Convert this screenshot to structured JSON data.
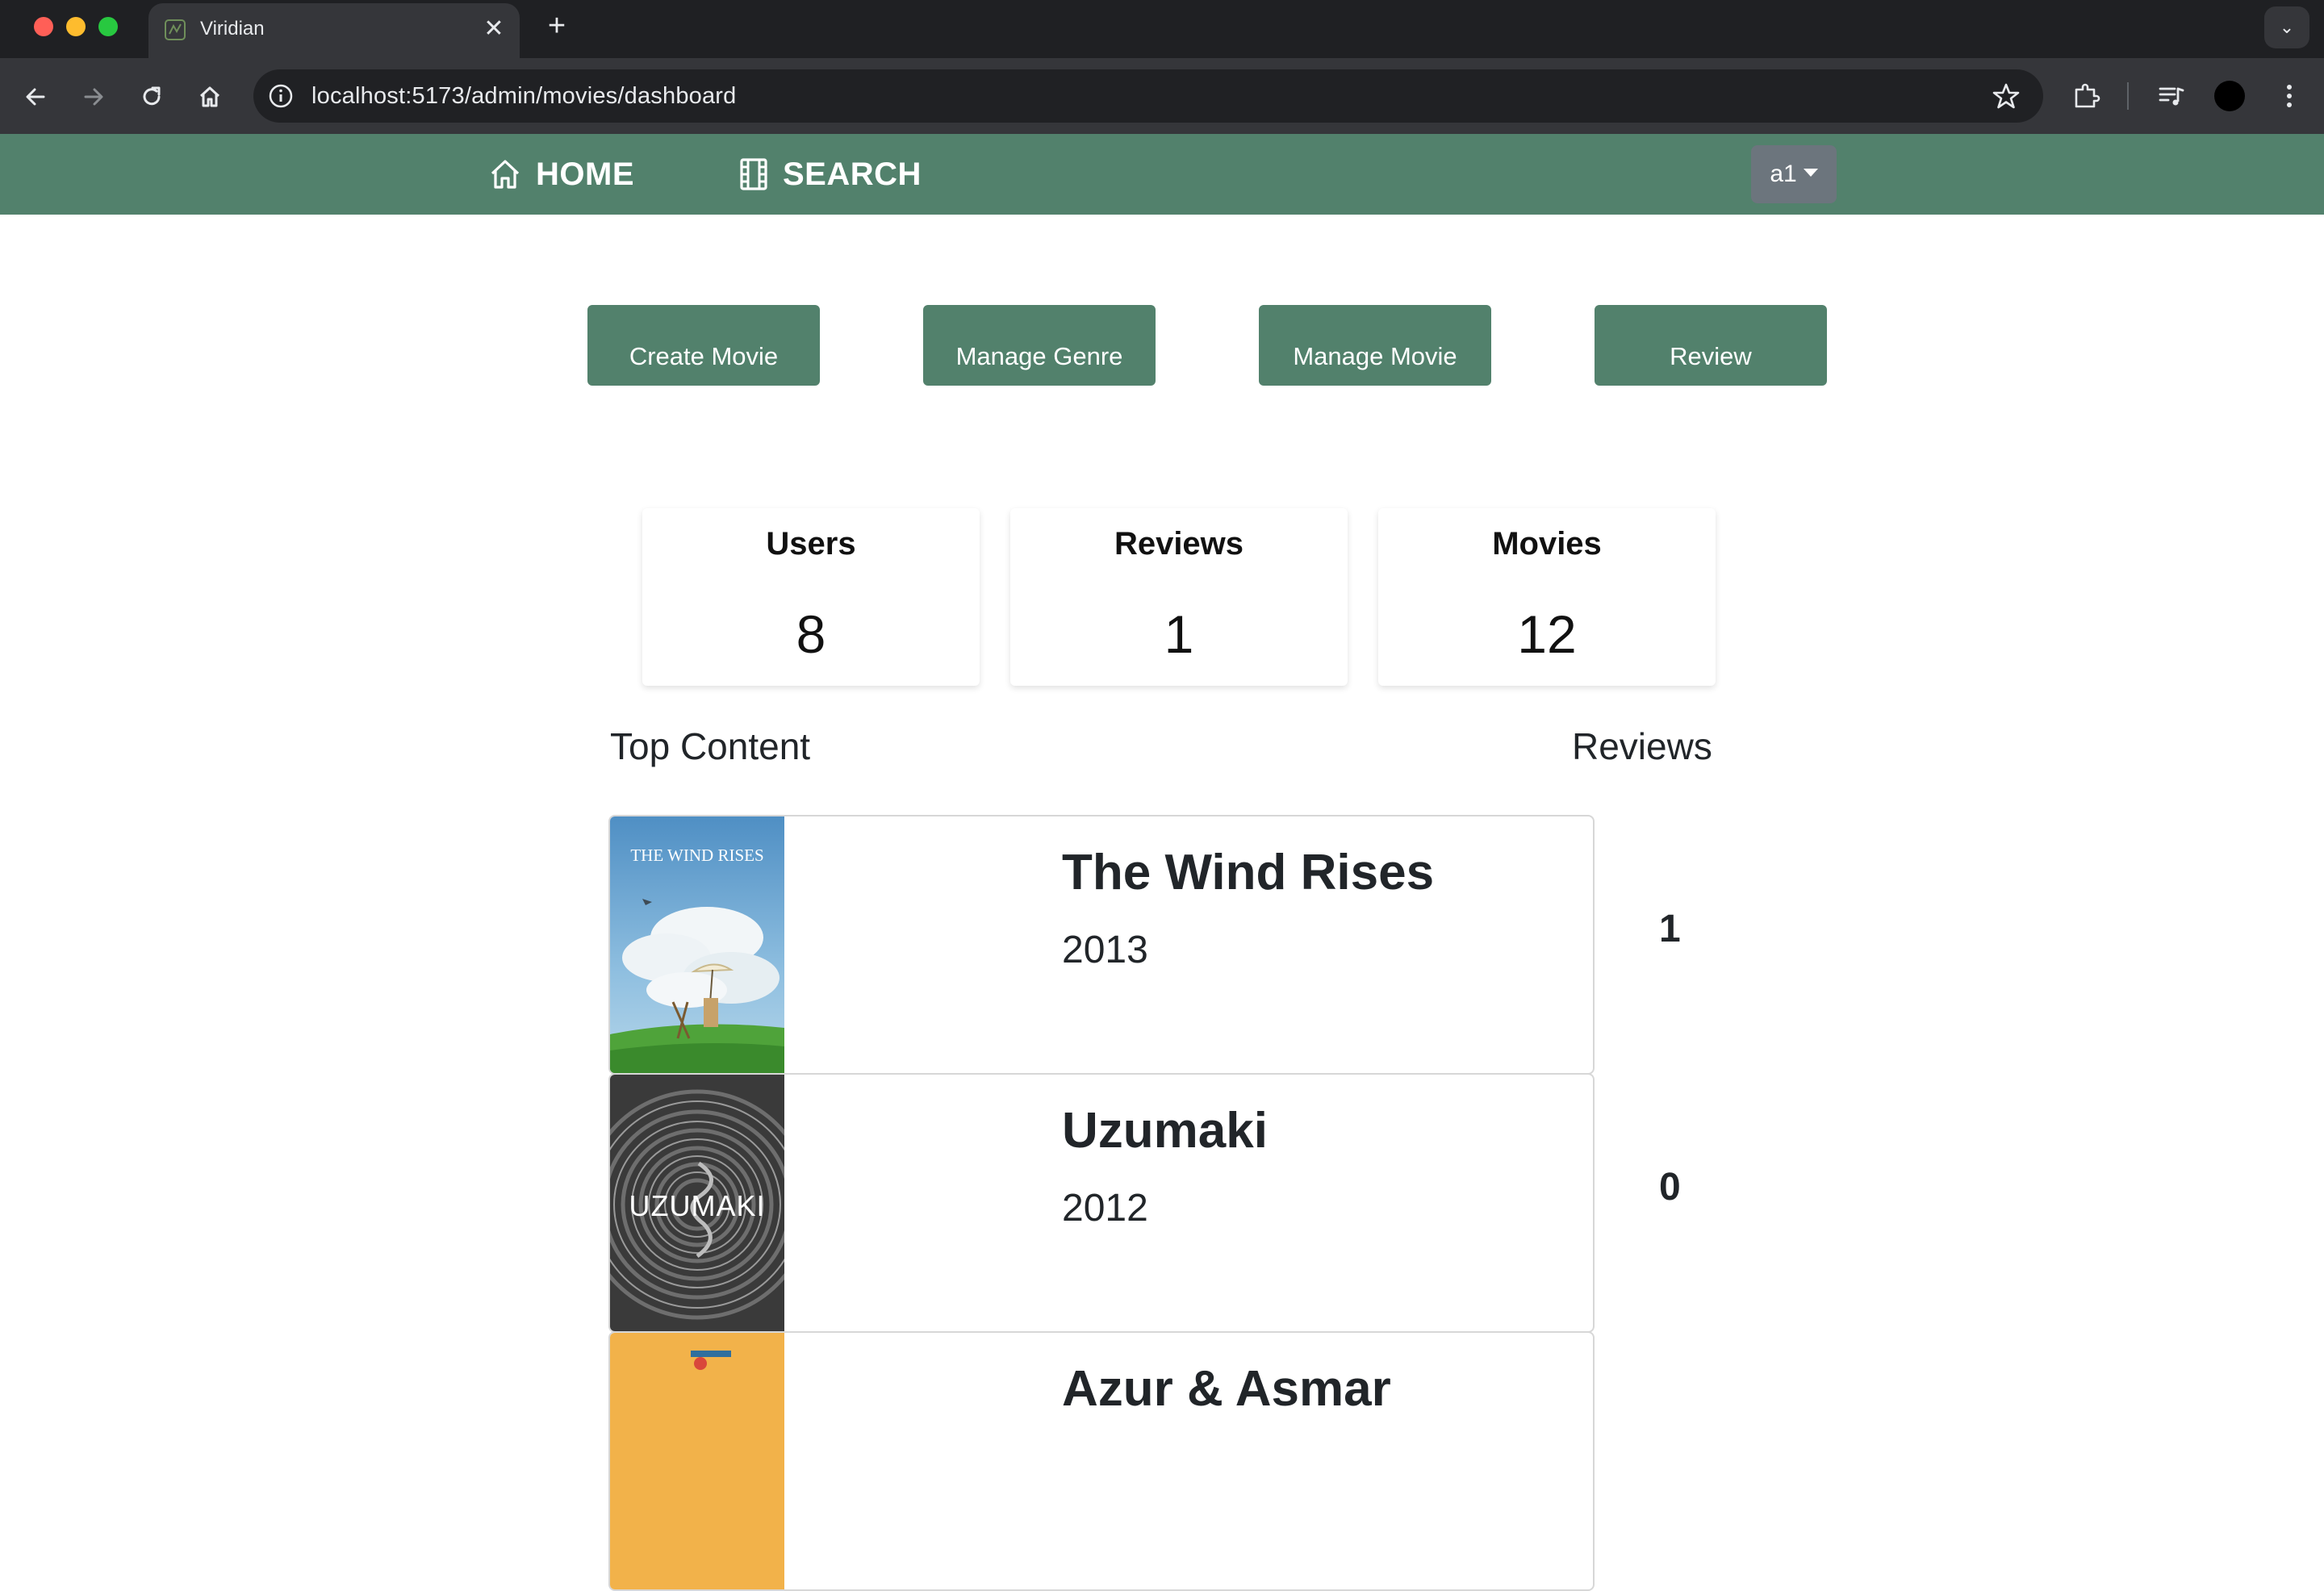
{
  "browser": {
    "tab_title": "Viridian",
    "url": "localhost:5173/admin/movies/dashboard",
    "new_tab_glyph": "+",
    "close_glyph": "✕",
    "tab_menu_glyph": "⌄"
  },
  "navbar": {
    "home_label": "HOME",
    "search_label": "SEARCH",
    "user_label": "a1",
    "bg_color": "#52816c"
  },
  "actions": {
    "create_movie": "Create Movie",
    "manage_genre": "Manage Genre",
    "manage_movie": "Manage Movie",
    "review": "Review"
  },
  "stats": {
    "users": {
      "label": "Users",
      "value": "8"
    },
    "reviews": {
      "label": "Reviews",
      "value": "1"
    },
    "movies": {
      "label": "Movies",
      "value": "12"
    }
  },
  "top_content": {
    "heading": "Top Content",
    "reviews_heading": "Reviews",
    "items": [
      {
        "title": "The Wind Rises",
        "year": "2013",
        "reviews": "1",
        "poster_text": "THE WIND RISES"
      },
      {
        "title": "Uzumaki",
        "year": "2012",
        "reviews": "0",
        "poster_text": "UZUMAKI"
      },
      {
        "title": "Azur & Asmar",
        "year": "",
        "reviews": ""
      }
    ]
  }
}
